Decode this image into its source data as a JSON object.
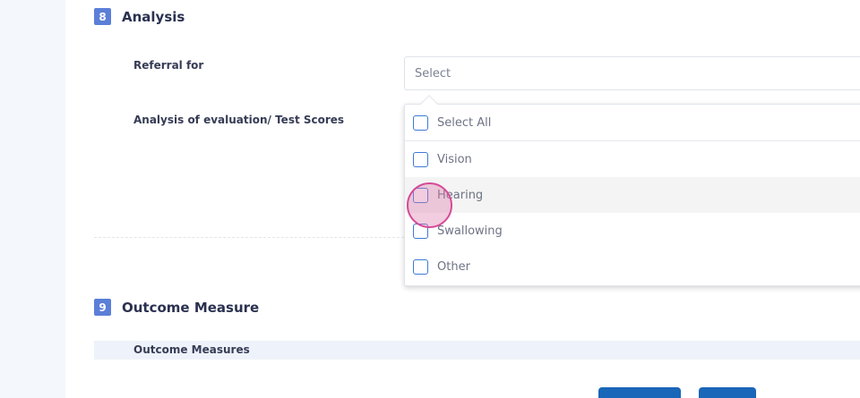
{
  "section_analysis": {
    "number": "8",
    "title": "Analysis"
  },
  "fields": {
    "referral_label": "Referral for",
    "analysis_label": "Analysis of evaluation/ Test Scores"
  },
  "referral_select": {
    "placeholder": "Select"
  },
  "dropdown": {
    "select_all": "Select All",
    "options": [
      "Vision",
      "Hearing",
      "Swallowing",
      "Other"
    ],
    "highlighted": "Hearing"
  },
  "section_outcome": {
    "number": "9",
    "title": "Outcome Measure"
  },
  "outcome_table": {
    "header": "Outcome Measures"
  },
  "colors": {
    "accent": "#1a66b8",
    "badge": "#5b7fd8",
    "checkbox": "#3d7ad6"
  }
}
